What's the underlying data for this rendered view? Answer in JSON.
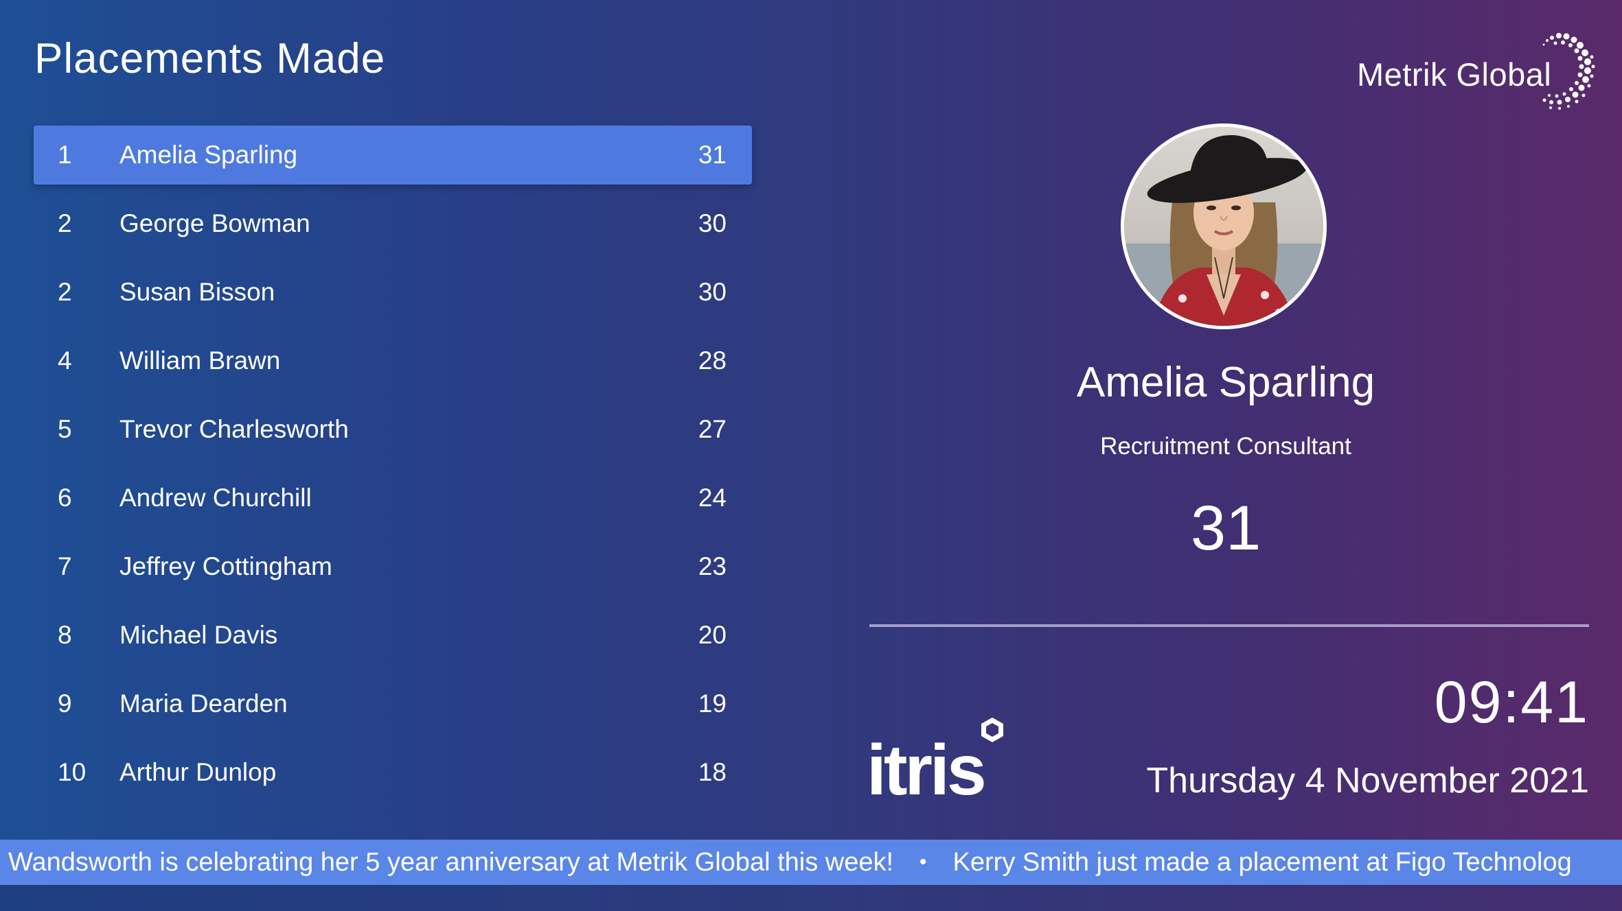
{
  "header": {
    "title": "Placements Made"
  },
  "brand": {
    "name": "Metrik Global",
    "mark_icon": "dotted-swirl-icon"
  },
  "leaderboard": {
    "rows": [
      {
        "rank": "1",
        "name": "Amelia Sparling",
        "count": "31",
        "highlighted": true
      },
      {
        "rank": "2",
        "name": "George Bowman",
        "count": "30"
      },
      {
        "rank": "2",
        "name": "Susan Bisson",
        "count": "30"
      },
      {
        "rank": "4",
        "name": "William Brawn",
        "count": "28"
      },
      {
        "rank": "5",
        "name": "Trevor Charlesworth",
        "count": "27"
      },
      {
        "rank": "6",
        "name": "Andrew Churchill",
        "count": "24"
      },
      {
        "rank": "7",
        "name": "Jeffrey Cottingham",
        "count": "23"
      },
      {
        "rank": "8",
        "name": "Michael Davis",
        "count": "20"
      },
      {
        "rank": "9",
        "name": "Maria Dearden",
        "count": "19"
      },
      {
        "rank": "10",
        "name": "Arthur Dunlop",
        "count": "18"
      }
    ]
  },
  "profile": {
    "name": "Amelia Sparling",
    "role": "Recruitment Consultant",
    "score": "31",
    "avatar_icon": "profile-photo"
  },
  "footer_logo": {
    "text": "itris"
  },
  "clock": {
    "time": "09:41",
    "date": "Thursday 4 November 2021"
  },
  "ticker": {
    "messages": [
      "Wandsworth is celebrating her 5 year anniversary at Metrik Global this week!",
      "Kerry Smith just made a placement at Figo Technolog"
    ],
    "separator": "•"
  },
  "colors": {
    "highlight": "#4e7ae0",
    "ticker": "#5a86e8",
    "gradient_start": "#1e4f95",
    "gradient_end": "#5a2a6a"
  }
}
